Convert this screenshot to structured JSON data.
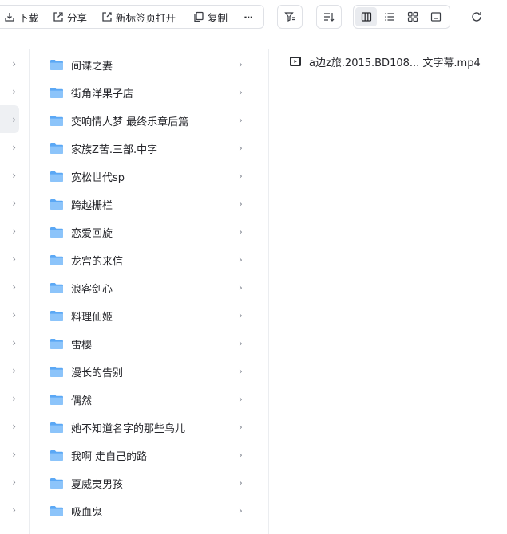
{
  "toolbar": {
    "download_label": "下载",
    "share_label": "分享",
    "open_new_tab_label": "新标签页打开",
    "copy_label": "复制",
    "more_label": "···"
  },
  "left_column": {
    "chevron": "›",
    "selected_index": 2
  },
  "folders": [
    "间谍之妻",
    "街角洋果子店",
    "交响情人梦 最终乐章后篇",
    "家族Z苦.三部.中字",
    "宽松世代sp",
    "跨越栅栏",
    "恋爱回旋",
    "龙宫的来信",
    "浪客剑心",
    "料理仙姬",
    "雷樱",
    "漫长的告别",
    "偶然",
    "她不知道名字的那些鸟儿",
    "我啊 走自己的路",
    "夏威夷男孩",
    "吸血鬼"
  ],
  "folder_chevron": "›",
  "files": [
    {
      "name": "a边z旅.2015.BD108... 文字幕.mp4",
      "icon": "video-file-icon"
    }
  ],
  "colors": {
    "folder_blue": "#5ba8f5",
    "folder_blue_light": "#8cc4fa",
    "border": "#dfe1e6",
    "selected_bg": "#eef0f3"
  }
}
